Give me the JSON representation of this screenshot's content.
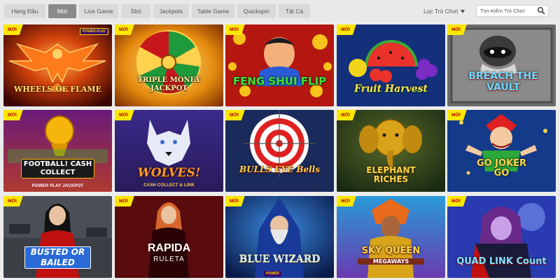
{
  "tabs": [
    {
      "label": "Hàng Đầu",
      "active": false
    },
    {
      "label": "Mới",
      "active": true
    },
    {
      "label": "Live Game",
      "active": false
    },
    {
      "label": "Slot",
      "active": false
    },
    {
      "label": "Jackpots",
      "active": false
    },
    {
      "label": "Table Game",
      "active": false
    },
    {
      "label": "Quickspin",
      "active": false
    },
    {
      "label": "Tất Cả",
      "active": false
    }
  ],
  "filter": {
    "label": "Lọc Trò Chơi",
    "icon": "funnel-icon"
  },
  "search": {
    "placeholder": "Tìm Kiếm Trò Chơi",
    "icon": "search-icon"
  },
  "new_badge": "MỚI",
  "games": [
    {
      "title": "WHEELS OF FLAME",
      "provider_badge": "POWER PLAY",
      "is_new": true
    },
    {
      "title": "TRIPLE MONEY JACKPOT",
      "is_new": true
    },
    {
      "title": "FENG SHUI FLIP",
      "is_new": true
    },
    {
      "title": "Fruit Harvest",
      "is_new": true
    },
    {
      "title": "BREACH THE VAULT",
      "is_new": true
    },
    {
      "title": "FOOTBALL! CASH COLLECT",
      "subtitle": "POWER PLAY JACKPOT",
      "is_new": true
    },
    {
      "title": "WOLVES!",
      "subtitle": "CASH COLLECT & LINK",
      "is_new": true
    },
    {
      "title": "BULLS EYE Bells",
      "is_new": true
    },
    {
      "title": "ELEPHANT RICHES",
      "is_new": true
    },
    {
      "title": "GO JOKER GO",
      "is_new": true
    },
    {
      "title": "BUSTED OR BAILED",
      "is_new": true
    },
    {
      "title": "RAPIDA",
      "subtitle": "RULETA",
      "is_new": true
    },
    {
      "title": "BLUE WIZARD",
      "provider_badge": "POWER",
      "is_new": true
    },
    {
      "title": "SKY QUEEN",
      "subtitle": "MEGAWAYS",
      "is_new": true
    },
    {
      "title": "QUAD LINK Count",
      "is_new": true
    }
  ],
  "colors": {
    "new_badge_bg": "#fde700",
    "new_badge_text": "#b10000",
    "active_tab": "#8a8a8a"
  }
}
